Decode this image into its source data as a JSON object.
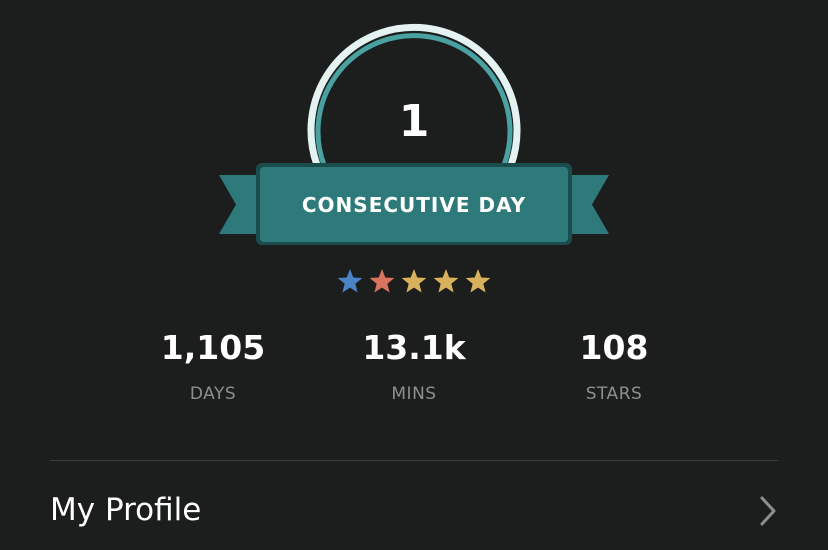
{
  "streak": {
    "count": "1",
    "label": "CONSECUTIVE DAY"
  },
  "star_rating": {
    "filled": 5,
    "total": 5,
    "colors": [
      "#4a84c4",
      "#d9745f",
      "#d8b25a",
      "#d8b25a",
      "#d8b25a"
    ]
  },
  "stats": [
    {
      "value": "1,105",
      "label": "DAYS"
    },
    {
      "value": "13.1k",
      "label": "MINS"
    },
    {
      "value": "108",
      "label": "STARS"
    }
  ],
  "menu": {
    "profile_label": "My Profile",
    "profile_icon": "chevron-right-icon"
  },
  "theme": {
    "background": "#1c1d1d",
    "banner_teal": "#2e7a7a",
    "banner_dark_teal": "#235f60",
    "ring_light": "#e4f2f2",
    "ring_teal": "#4aa1a1",
    "muted_text": "#8d8f8f"
  }
}
